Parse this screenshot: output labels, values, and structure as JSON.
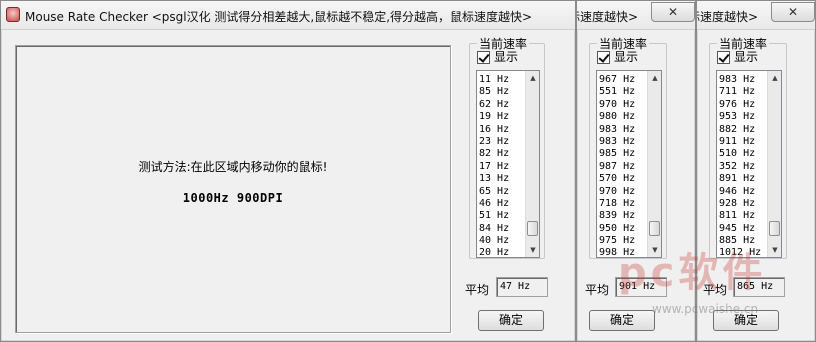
{
  "window": {
    "title": "Mouse Rate Checker <psgl汉化  测试得分相差越大,鼠标越不稳定,得分越高，鼠标速度越快>",
    "title_fragment": "标速度越快>",
    "close_symbol": "✕"
  },
  "main_area": {
    "instruction": "测试方法:在此区域内移动你的鼠标!",
    "spec": "1000Hz 900DPI"
  },
  "panels": [
    {
      "group_label": "当前速率",
      "checkbox_label": "显示",
      "checkbox_checked": true,
      "rates": [
        "11 Hz",
        "85 Hz",
        "62 Hz",
        "19 Hz",
        "16 Hz",
        "23 Hz",
        "82 Hz",
        "17 Hz",
        "13 Hz",
        "65 Hz",
        "46 Hz",
        "51 Hz",
        "84 Hz",
        "40 Hz",
        "20 Hz"
      ],
      "avg_label": "平均",
      "avg_value": "47 Hz",
      "ok_label": "确定"
    },
    {
      "group_label": "当前速率",
      "checkbox_label": "显示",
      "checkbox_checked": true,
      "rates": [
        "967 Hz",
        "551 Hz",
        "970 Hz",
        "980 Hz",
        "983 Hz",
        "983 Hz",
        "985 Hz",
        "987 Hz",
        "570 Hz",
        "970 Hz",
        "718 Hz",
        "839 Hz",
        "950 Hz",
        "975 Hz",
        "998 Hz"
      ],
      "avg_label": "平均",
      "avg_value": "901 Hz",
      "ok_label": "确定"
    },
    {
      "group_label": "当前速率",
      "checkbox_label": "显示",
      "checkbox_checked": true,
      "rates": [
        "983 Hz",
        "711 Hz",
        "976 Hz",
        "953 Hz",
        "882 Hz",
        "911 Hz",
        "510 Hz",
        "352 Hz",
        "891 Hz",
        "946 Hz",
        "928 Hz",
        "811 Hz",
        "945 Hz",
        "885 Hz",
        "1012 Hz"
      ],
      "avg_label": "平均",
      "avg_value": "865 Hz",
      "ok_label": "确定"
    }
  ],
  "watermark": {
    "logo": "pc软件",
    "url": "www.pcwaishe.cn"
  },
  "colors": {
    "window_bg": "#f0f0f0",
    "list_bg": "#ffffff"
  }
}
